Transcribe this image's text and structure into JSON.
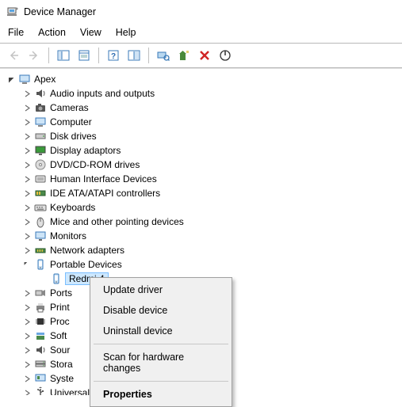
{
  "window": {
    "title": "Device Manager"
  },
  "menubar": {
    "file": "File",
    "action": "Action",
    "view": "View",
    "help": "Help"
  },
  "toolbar": {
    "back": "Back",
    "forward": "Forward",
    "show_hide": "Show/Hide Console Tree",
    "properties": "Properties",
    "help": "Help",
    "action_center": "Action Center",
    "scan": "Scan for hardware changes",
    "update": "Update device drivers",
    "disable": "Disable device",
    "uninstall": "Uninstall device"
  },
  "tree": {
    "root": "Apex",
    "items": [
      "Audio inputs and outputs",
      "Cameras",
      "Computer",
      "Disk drives",
      "Display adaptors",
      "DVD/CD-ROM drives",
      "Human Interface Devices",
      "IDE ATA/ATAPI controllers",
      "Keyboards",
      "Mice and other pointing devices",
      "Monitors",
      "Network adapters",
      "Portable Devices",
      "Ports",
      "Print",
      "Proc",
      "Soft",
      "Sour",
      "Stora",
      "Syste",
      "Universal Serial Bus controllers"
    ],
    "portable_child": "Redmi 4"
  },
  "context_menu": {
    "update": "Update driver",
    "disable": "Disable device",
    "uninstall": "Uninstall device",
    "scan": "Scan for hardware changes",
    "properties": "Properties"
  }
}
